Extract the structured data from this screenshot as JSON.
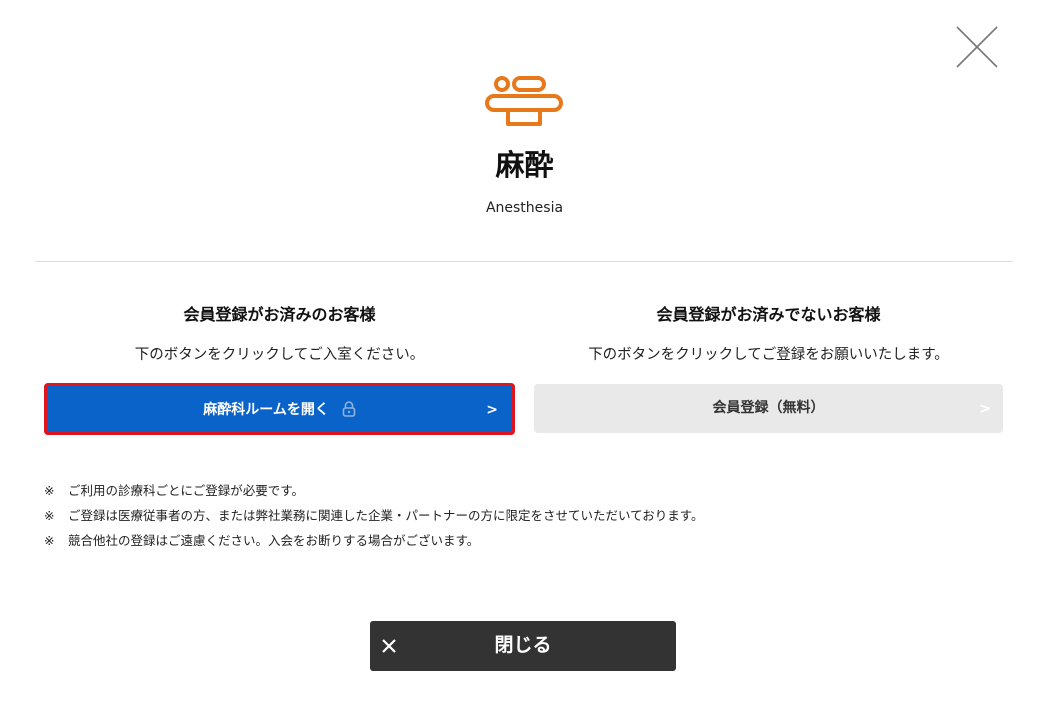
{
  "dialog": {
    "close_icon": "close-x-icon",
    "department": {
      "icon": "anesthesia-bed-icon",
      "icon_color": "#e8791a",
      "title": "麻酔",
      "subtitle": "Anesthesia"
    },
    "members": {
      "heading": "会員登録がお済みのお客様",
      "description": "下のボタンをクリックしてご入室ください。",
      "button_label": "麻酔科ルームを開く",
      "button_icon": "lock-icon",
      "button_color": "#0a63c9",
      "highlight_color": "#e0141c",
      "chevron": ">"
    },
    "non_members": {
      "heading": "会員登録がお済みでないお客様",
      "description": "下のボタンをクリックしてご登録をお願いいたします。",
      "button_label": "会員登録（無料）",
      "chevron": ">"
    },
    "notes": [
      {
        "mark": "※",
        "text": "ご利用の診療科ごとにご登録が必要です。"
      },
      {
        "mark": "※",
        "text": "ご登録は医療従事者の方、または弊社業務に関連した企業・パートナーの方に限定をさせていただいております。"
      },
      {
        "mark": "※",
        "text": "競合他社の登録はご遠慮ください。入会をお断りする場合がございます。"
      }
    ],
    "close_button": {
      "label": "閉じる",
      "icon": "close-icon"
    }
  }
}
